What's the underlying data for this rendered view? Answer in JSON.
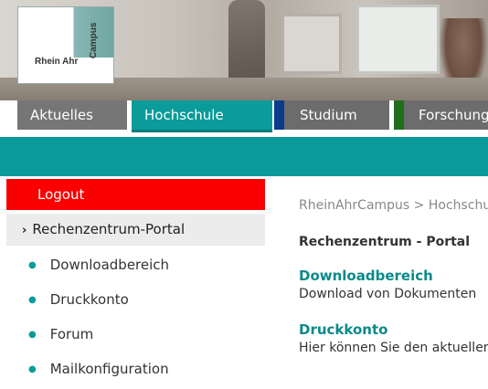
{
  "logo": {
    "name": "Rhein Ahr",
    "vertical": "Campus"
  },
  "tabs": [
    {
      "label": "Aktuelles",
      "color": "#767676",
      "mark": "#8a8a8a"
    },
    {
      "label": "Hochschule",
      "color": "#0a9b9a",
      "mark": "#0a9b9a"
    },
    {
      "label": "Studium",
      "color": "#6c6c6c",
      "mark": "#0a3b8c"
    },
    {
      "label": "Forschung",
      "color": "#6c6c6c",
      "mark": "#1e6e1e"
    }
  ],
  "sidebar": {
    "logout": "Logout",
    "portal": "Rechenzentrum-Portal",
    "items": [
      "Downloadbereich",
      "Druckkonto",
      "Forum",
      "Mailkonfiguration"
    ]
  },
  "main": {
    "breadcrumb": "RheinAhrCampus > Hochschule",
    "title": "Rechenzentrum - Portal",
    "sections": [
      {
        "title": "Downloadbereich",
        "text": "Download von Dokumenten"
      },
      {
        "title": "Druckkonto",
        "text": "Hier können Sie den aktuellen"
      }
    ]
  },
  "colors": {
    "accent": "#0a9b9a",
    "logout": "#fb0000"
  }
}
